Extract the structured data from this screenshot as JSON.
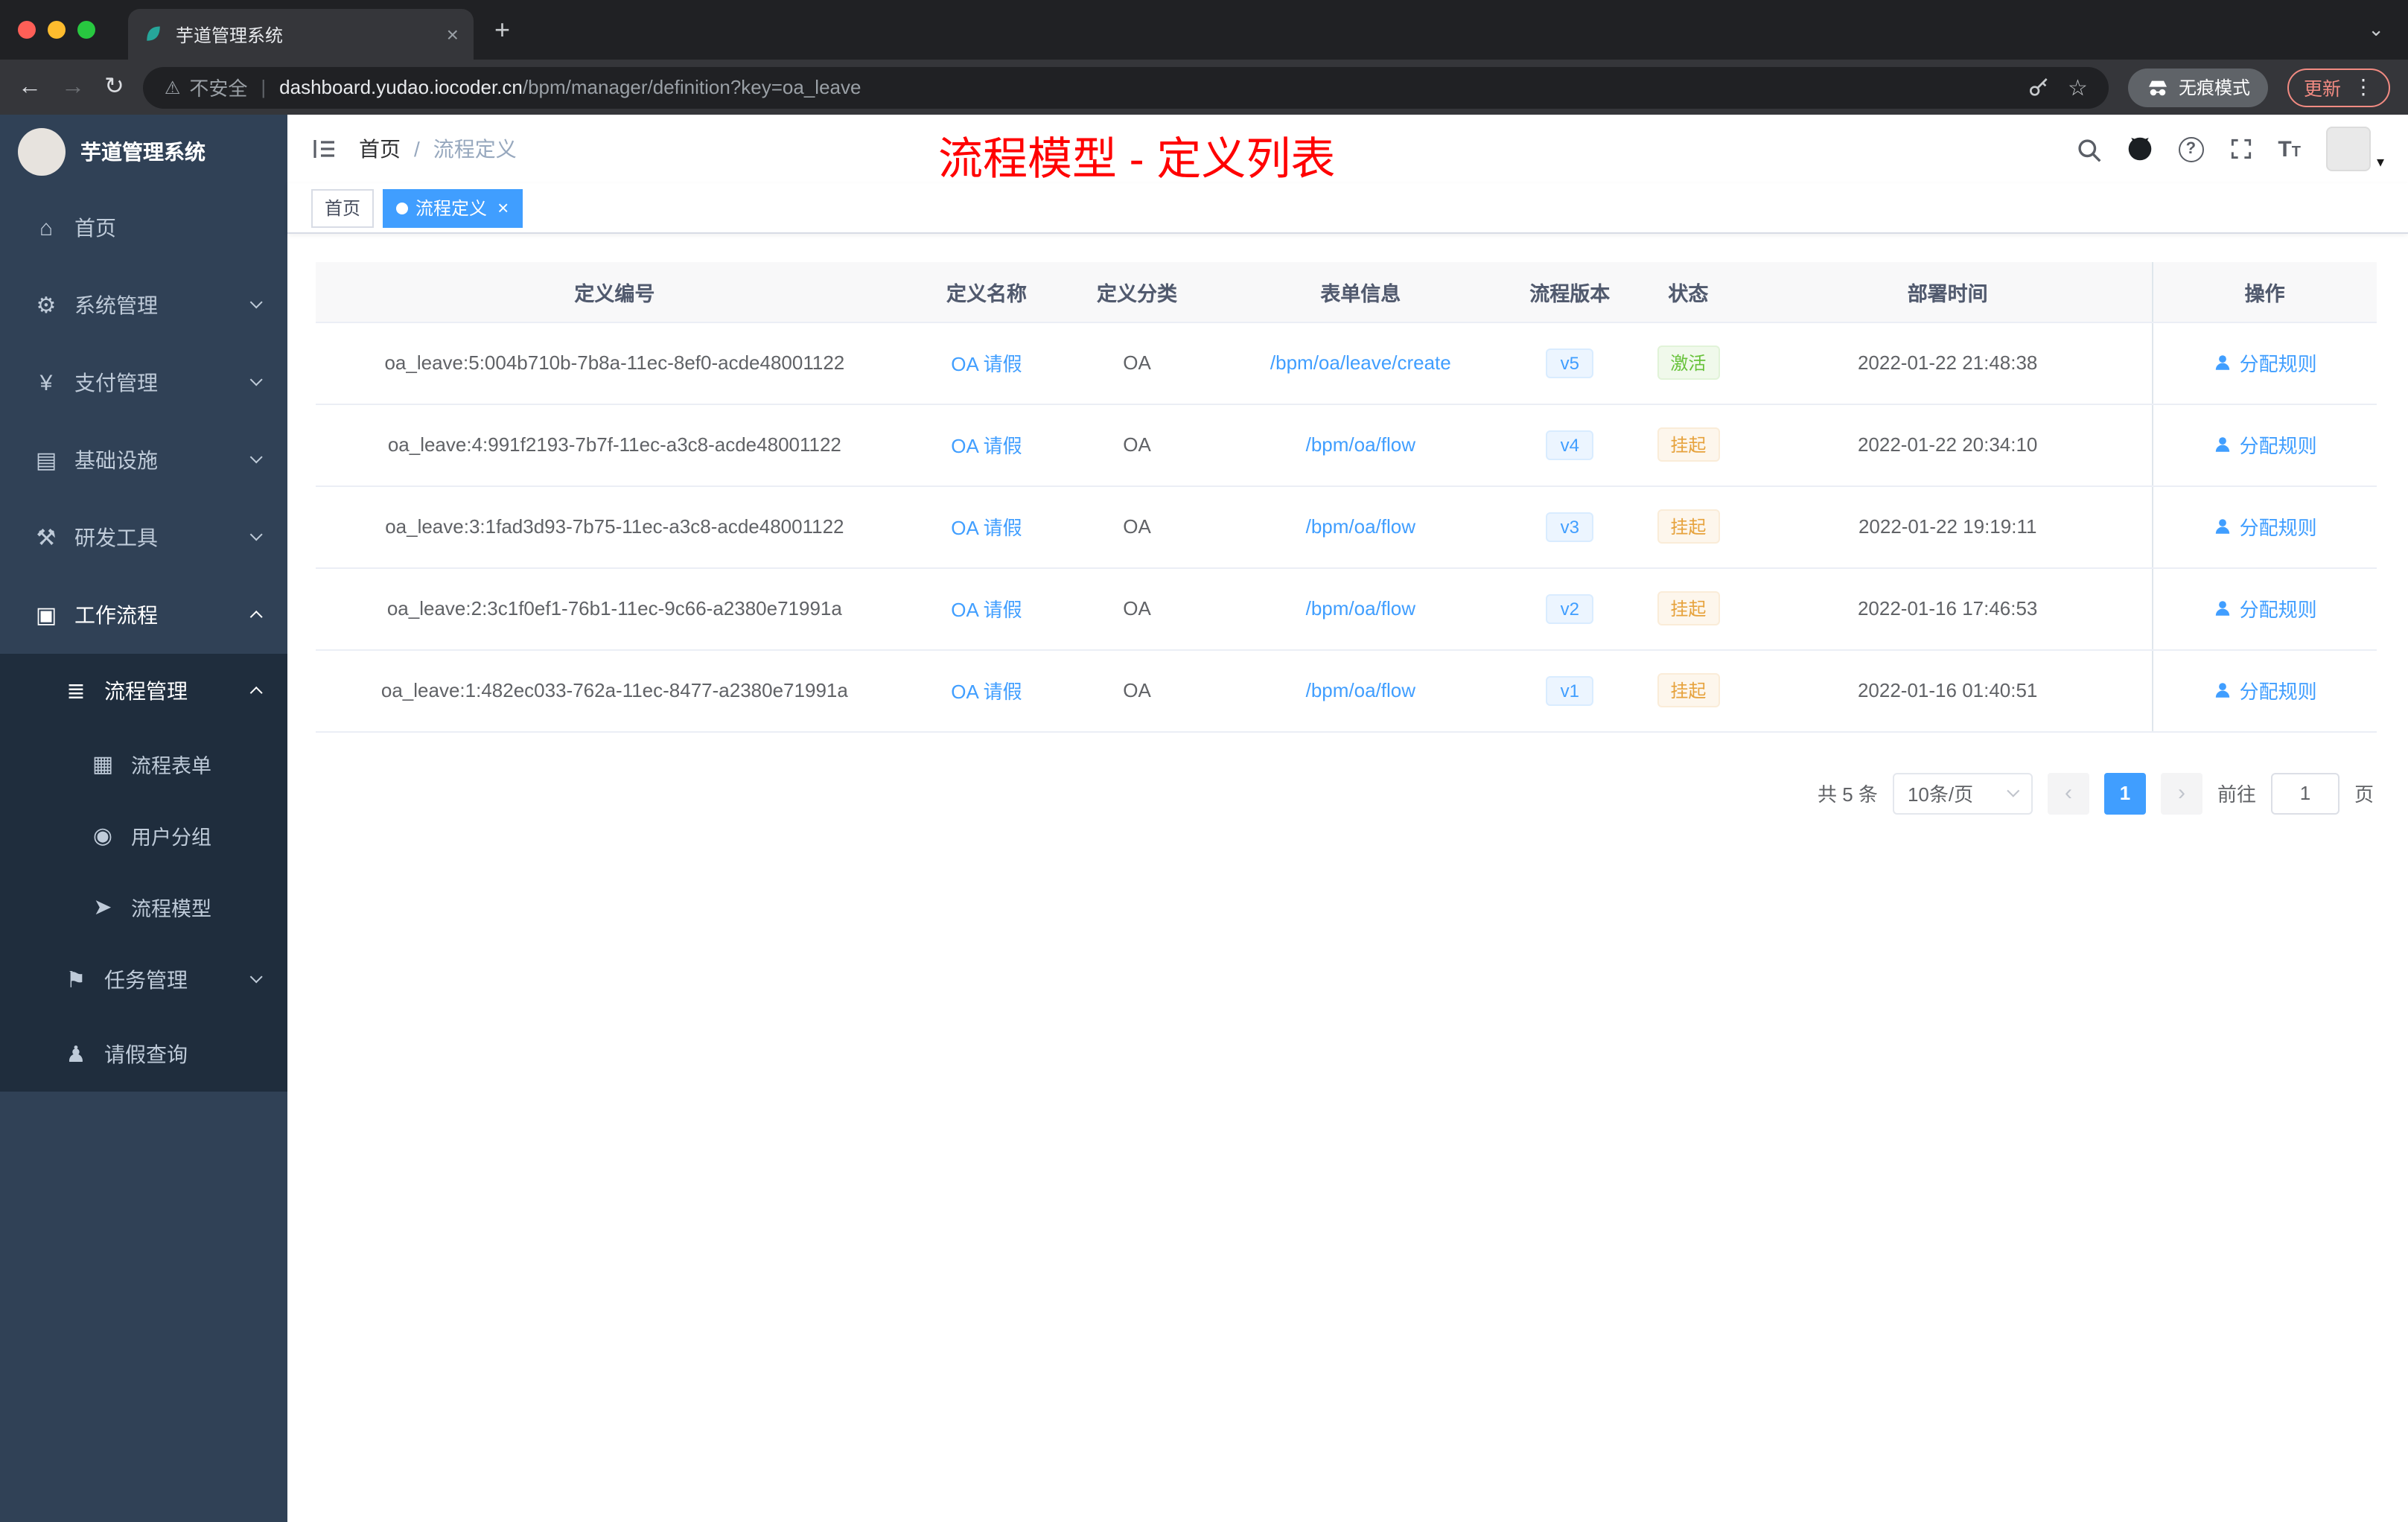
{
  "browser": {
    "tab": {
      "title": "芋道管理系统"
    },
    "toolbar": {
      "security_label": "不安全",
      "url_domain": "dashboard.yudao.iocoder.cn",
      "url_path": "/bpm/manager/definition?key=oa_leave",
      "incognito_label": "无痕模式",
      "update_label": "更新"
    }
  },
  "sidebar": {
    "logo_title": "芋道管理系统",
    "items": [
      {
        "label": "首页",
        "icon": "home-icon",
        "level": 1
      },
      {
        "label": "系统管理",
        "icon": "gear-icon",
        "level": 1,
        "chevron": "down"
      },
      {
        "label": "支付管理",
        "icon": "payment-icon",
        "level": 1,
        "chevron": "down"
      },
      {
        "label": "基础设施",
        "icon": "infrastructure-icon",
        "level": 1,
        "chevron": "down"
      },
      {
        "label": "研发工具",
        "icon": "devtools-icon",
        "level": 1,
        "chevron": "down"
      },
      {
        "label": "工作流程",
        "icon": "workflow-icon",
        "level": 1,
        "chevron": "up",
        "active": true
      },
      {
        "label": "流程管理",
        "icon": "process-manage-icon",
        "level": 2,
        "chevron": "up",
        "active": true,
        "dark": true
      },
      {
        "label": "流程表单",
        "icon": "process-form-icon",
        "level": 3,
        "dark": true
      },
      {
        "label": "用户分组",
        "icon": "user-group-icon",
        "level": 3,
        "dark": true
      },
      {
        "label": "流程模型",
        "icon": "process-model-icon",
        "level": 3,
        "dark": true
      },
      {
        "label": "任务管理",
        "icon": "task-manage-icon",
        "level": 2,
        "chevron": "down",
        "dark": true
      },
      {
        "label": "请假查询",
        "icon": "leave-query-icon",
        "level": 2,
        "dark": true
      }
    ]
  },
  "header": {
    "breadcrumb": [
      "首页",
      "流程定义"
    ],
    "overlay_title": "流程模型 - 定义列表"
  },
  "tags": [
    {
      "label": "首页",
      "active": false,
      "closable": false
    },
    {
      "label": "流程定义",
      "active": true,
      "closable": true
    }
  ],
  "table": {
    "columns": [
      "定义编号",
      "定义名称",
      "定义分类",
      "表单信息",
      "流程版本",
      "状态",
      "部署时间",
      "操作"
    ],
    "rows": [
      {
        "id": "oa_leave:5:004b710b-7b8a-11ec-8ef0-acde48001122",
        "name": "OA 请假",
        "category": "OA",
        "form": "/bpm/oa/leave/create",
        "version": "v5",
        "status": "激活",
        "status_type": "success",
        "deploy_time": "2022-01-22 21:48:38",
        "action": "分配规则"
      },
      {
        "id": "oa_leave:4:991f2193-7b7f-11ec-a3c8-acde48001122",
        "name": "OA 请假",
        "category": "OA",
        "form": "/bpm/oa/flow",
        "version": "v4",
        "status": "挂起",
        "status_type": "warning",
        "deploy_time": "2022-01-22 20:34:10",
        "action": "分配规则"
      },
      {
        "id": "oa_leave:3:1fad3d93-7b75-11ec-a3c8-acde48001122",
        "name": "OA 请假",
        "category": "OA",
        "form": "/bpm/oa/flow",
        "version": "v3",
        "status": "挂起",
        "status_type": "warning",
        "deploy_time": "2022-01-22 19:19:11",
        "action": "分配规则"
      },
      {
        "id": "oa_leave:2:3c1f0ef1-76b1-11ec-9c66-a2380e71991a",
        "name": "OA 请假",
        "category": "OA",
        "form": "/bpm/oa/flow",
        "version": "v2",
        "status": "挂起",
        "status_type": "warning",
        "deploy_time": "2022-01-16 17:46:53",
        "action": "分配规则"
      },
      {
        "id": "oa_leave:1:482ec033-762a-11ec-8477-a2380e71991a",
        "name": "OA 请假",
        "category": "OA",
        "form": "/bpm/oa/flow",
        "version": "v1",
        "status": "挂起",
        "status_type": "warning",
        "deploy_time": "2022-01-16 01:40:51",
        "action": "分配规则"
      }
    ]
  },
  "pagination": {
    "total_label": "共 5 条",
    "page_size_label": "10条/页",
    "current_page": "1",
    "goto_label": "前往",
    "goto_value": "1",
    "page_unit_label": "页"
  }
}
